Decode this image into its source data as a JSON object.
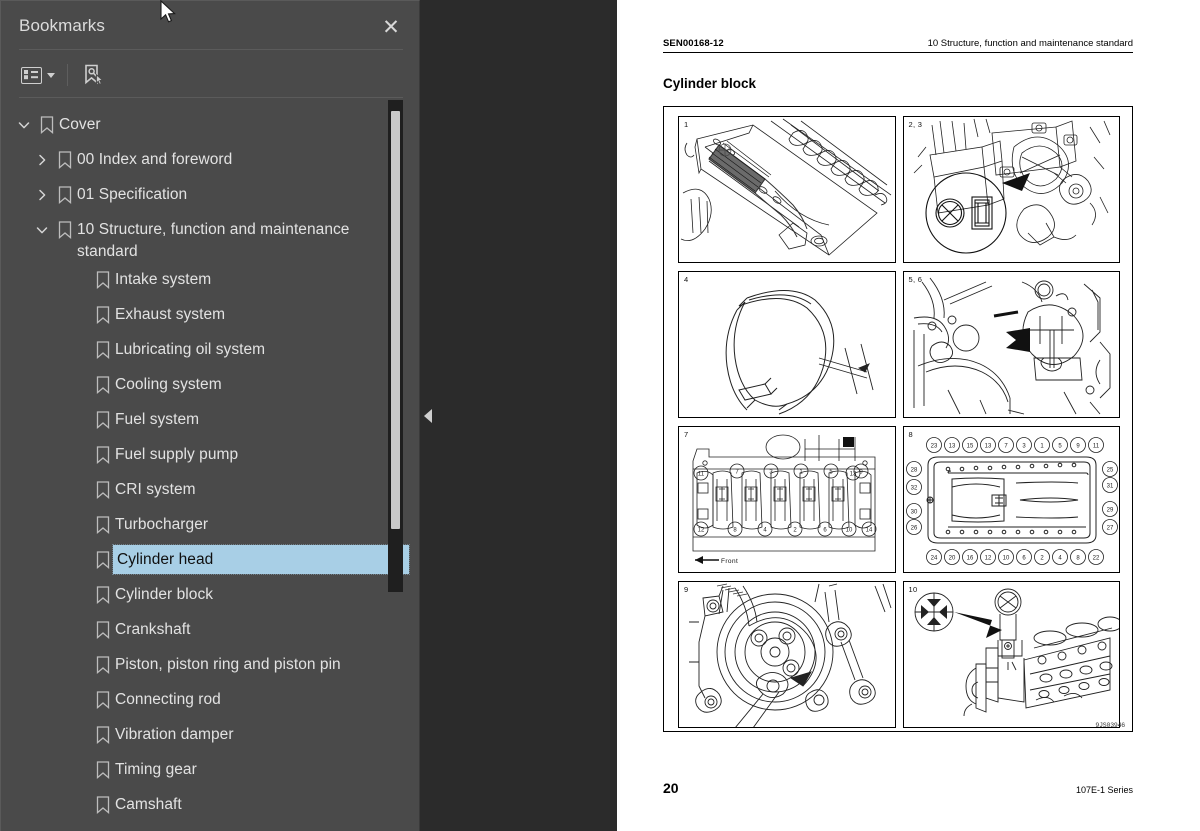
{
  "panel": {
    "title": "Bookmarks",
    "close_label": "✕",
    "toolbar": {
      "options_icon": "list-options-icon",
      "options_caret": "chevron-down-icon",
      "find_bookmark_icon": "find-bookmark-icon"
    }
  },
  "bookmarks": [
    {
      "label": "Cover",
      "level": 0,
      "state": "expanded",
      "selected": false
    },
    {
      "label": "00 Index and foreword",
      "level": 1,
      "state": "collapsed",
      "selected": false
    },
    {
      "label": "01 Specification",
      "level": 1,
      "state": "collapsed",
      "selected": false
    },
    {
      "label": "10 Structure, function and maintenance standard",
      "level": 1,
      "state": "expanded",
      "selected": false,
      "wrap": true
    },
    {
      "label": "Intake system",
      "level": 2,
      "state": "leaf",
      "selected": false
    },
    {
      "label": "Exhaust system",
      "level": 2,
      "state": "leaf",
      "selected": false
    },
    {
      "label": "Lubricating oil system",
      "level": 2,
      "state": "leaf",
      "selected": false
    },
    {
      "label": "Cooling system",
      "level": 2,
      "state": "leaf",
      "selected": false
    },
    {
      "label": "Fuel system",
      "level": 2,
      "state": "leaf",
      "selected": false
    },
    {
      "label": "Fuel supply pump",
      "level": 2,
      "state": "leaf",
      "selected": false
    },
    {
      "label": "CRI system",
      "level": 2,
      "state": "leaf",
      "selected": false
    },
    {
      "label": "Turbocharger",
      "level": 2,
      "state": "leaf",
      "selected": false
    },
    {
      "label": "Cylinder head",
      "level": 2,
      "state": "leaf",
      "selected": true
    },
    {
      "label": "Cylinder block",
      "level": 2,
      "state": "leaf",
      "selected": false
    },
    {
      "label": "Crankshaft",
      "level": 2,
      "state": "leaf",
      "selected": false
    },
    {
      "label": "Piston, piston ring and piston pin",
      "level": 2,
      "state": "leaf",
      "selected": false
    },
    {
      "label": "Connecting rod",
      "level": 2,
      "state": "leaf",
      "selected": false
    },
    {
      "label": "Vibration damper",
      "level": 2,
      "state": "leaf",
      "selected": false
    },
    {
      "label": "Timing gear",
      "level": 2,
      "state": "leaf",
      "selected": false
    },
    {
      "label": "Camshaft",
      "level": 2,
      "state": "leaf",
      "selected": false
    }
  ],
  "document": {
    "header": {
      "doc_code": "SEN00168-12",
      "section": "10 Structure, function and maintenance standard"
    },
    "title": "Cylinder block",
    "figure_id": "9JS03946",
    "panels": [
      {
        "no": "1",
        "caption": ""
      },
      {
        "no": "2, 3",
        "caption": ""
      },
      {
        "no": "4",
        "caption": ""
      },
      {
        "no": "5, 6",
        "caption": ""
      },
      {
        "no": "7",
        "caption": "Front"
      },
      {
        "no": "8",
        "caption": ""
      },
      {
        "no": "9",
        "caption": ""
      },
      {
        "no": "10",
        "caption": ""
      }
    ],
    "footer": {
      "page_number": "20",
      "series": "107E-1 Series"
    }
  },
  "colors": {
    "panel_bg": "#4a4a4a",
    "gutter_bg": "#2b2b2b",
    "selection": "#a8cfe6",
    "text": "#e2e2e2",
    "page_bg": "#ffffff"
  }
}
